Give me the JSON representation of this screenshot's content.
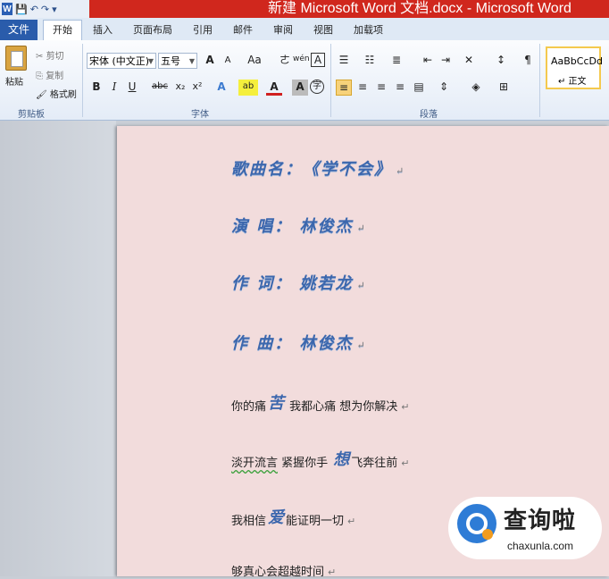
{
  "titlebar": {
    "title": "新建 Microsoft Word 文档.docx  -  Microsoft Word",
    "word_icon": "W",
    "save_glyph": "💾",
    "undo_glyph": "↶",
    "redo_glyph": "↷",
    "customize_glyph": "▾"
  },
  "tabs": {
    "file": "文件",
    "items": [
      "开始",
      "插入",
      "页面布局",
      "引用",
      "邮件",
      "审阅",
      "视图",
      "加载项"
    ]
  },
  "clipboard": {
    "paste": "粘贴",
    "cut": "剪切",
    "copy": "复制",
    "format_painter": "格式刷",
    "group": "剪贴板"
  },
  "font": {
    "name": "宋体 (中文正)",
    "size": "五号",
    "grow": "A",
    "shrink": "A",
    "change_case": "Aa",
    "clear_format": "ㄜ",
    "phonetic": "wén",
    "border": "A",
    "bold": "B",
    "italic": "I",
    "underline": "U",
    "strike": "abc",
    "subscript": "x₂",
    "superscript": "x²",
    "text_effect": "A",
    "highlight": "ab",
    "font_color": "A",
    "shading": "A",
    "enclose": "字",
    "group": "字体"
  },
  "paragraph": {
    "group": "段落"
  },
  "styles": {
    "sample": "AaBbCcDd",
    "name": "↵ 正文"
  },
  "document": {
    "headings": [
      "歌曲名：《学不会》",
      "演  唱：  林俊杰",
      "作  词：  姚若龙",
      "作  曲：  林俊杰"
    ],
    "para_mark": "↵",
    "lyric1": {
      "a": "你的痛",
      "big": "苦",
      "b": " 我都心痛 想为你解决"
    },
    "lyric2": {
      "a": "淡开流言",
      "b": " 紧握你手 ",
      "big": "想",
      "c": "飞奔往前"
    },
    "lyric3": {
      "a": "我相信",
      "big": "爱",
      "b": "能证明一切"
    },
    "lyric4": "够真心会超越时间"
  },
  "watermark": {
    "cn": "查询啦",
    "url": "chaxunla.com"
  },
  "colors": {
    "titlebar": "#d0271d",
    "file_tab": "#2a5cab",
    "page": "#f2dcdc",
    "heading_blue": "#3c67ad"
  }
}
